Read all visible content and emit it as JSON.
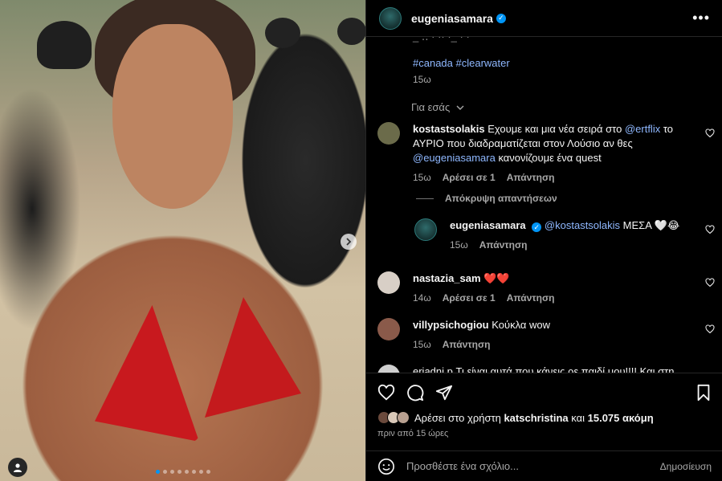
{
  "header": {
    "username": "eugeniasamara",
    "more_icon": "more-horizontal-icon"
  },
  "caption": {
    "hashtags": [
      "#canada",
      "#clearwater"
    ],
    "time": "15ω"
  },
  "for_you_label": "Για εσάς",
  "comments": [
    {
      "username": "kostastsolakis",
      "text_parts": [
        "Εχουμε και μια νέα σειρά στο ",
        "@ertflix",
        " το ΑΥΡΙΟ που διαδραματίζεται στον Λούσιο αν θες ",
        "@eugeniasamara",
        " κανονίζουμε ένα quest"
      ],
      "time": "15ω",
      "likes": "Αρέσει σε 1",
      "reply": "Απάντηση",
      "avatar_color": "#6b6b4a"
    },
    {
      "username": "eugeniasamara",
      "mention": "@kostastsolakis",
      "text": " ΜΕΣΑ 🤍😂",
      "time": "15ω",
      "reply": "Απάντηση",
      "avatar_color": "#1f5959"
    },
    {
      "username": "nastazia_sam",
      "text": " ❤️❤️",
      "time": "14ω",
      "likes": "Αρέσει σε 1",
      "reply": "Απάντηση",
      "avatar_color": "#d8cfc6"
    },
    {
      "username": "villypsichogiou",
      "text": " Κούκλα wow",
      "time": "15ω",
      "reply": "Απάντηση",
      "avatar_color": "#8a5a4a"
    },
    {
      "partial_text": "eriadni.p Τι είναι αυτά που κάνεις ρε παιδί μου!!!! Και στη",
      "avatar_color": "#cfcfcf"
    }
  ],
  "hide_replies": "Απόκρυψη απαντήσεων",
  "likes": {
    "prefix": "Αρέσει στο χρήστη ",
    "user": "katschristina",
    "middle": " και ",
    "count": "15.075 ακόμη"
  },
  "post_time": "πριν από 15 ώρες",
  "add_comment": {
    "placeholder": "Προσθέστε ένα σχόλιο...",
    "post_label": "Δημοσίευση"
  },
  "carousel": {
    "total_slides": 8,
    "active_slide": 1
  },
  "colors": {
    "accent": "#0095f6",
    "mention": "#8fb8ff",
    "heart_red": "#ed4956"
  }
}
